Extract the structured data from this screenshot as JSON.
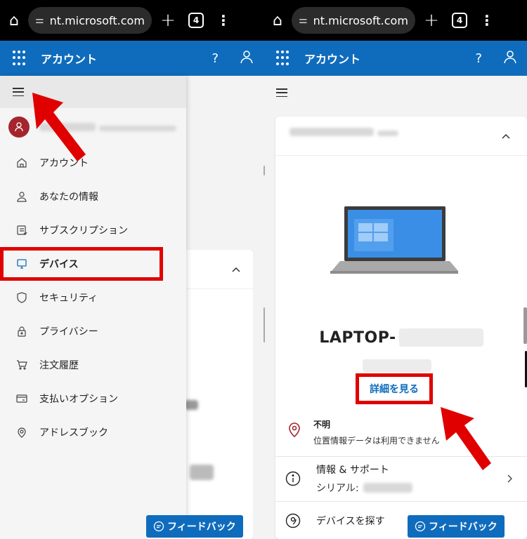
{
  "left": {
    "browser": {
      "url": "nt.microsoft.com",
      "tab_count": "4"
    },
    "header": {
      "title": "アカウント",
      "help": "?"
    },
    "nav": [
      {
        "label": "アカウント",
        "icon": "home-icon"
      },
      {
        "label": "あなたの情報",
        "icon": "person-icon"
      },
      {
        "label": "サブスクリプション",
        "icon": "subscription-icon"
      },
      {
        "label": "デバイス",
        "icon": "laptop-icon",
        "active": true
      },
      {
        "label": "セキュリティ",
        "icon": "shield-icon"
      },
      {
        "label": "プライバシー",
        "icon": "lock-icon"
      },
      {
        "label": "注文履歴",
        "icon": "cart-icon"
      },
      {
        "label": "支払いオプション",
        "icon": "card-icon"
      },
      {
        "label": "アドレスブック",
        "icon": "location-icon"
      }
    ],
    "feedback": "フィードバック"
  },
  "right": {
    "browser": {
      "url": "nt.microsoft.com",
      "tab_count": "4"
    },
    "header": {
      "title": "アカウント",
      "help": "?"
    },
    "device": {
      "name": "LAPTOP-",
      "details_link": "詳細を見る",
      "location_title": "不明",
      "location_desc": "位置情報データは利用できません",
      "info_title": "情報 & サポート",
      "info_serial_label": "シリアル:",
      "find_device": "デバイスを探す"
    },
    "feedback": "フィードバック"
  },
  "colors": {
    "brand": "#0f6cbd",
    "highlight": "#e00000",
    "avatar": "#a4262c"
  }
}
